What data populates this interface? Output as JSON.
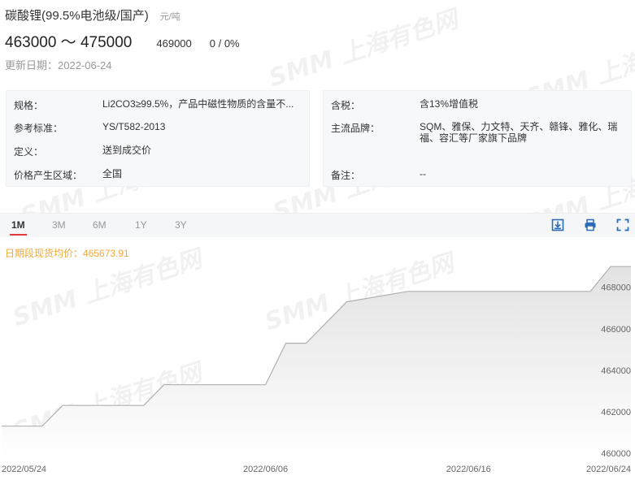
{
  "product": {
    "title": "碳酸锂(99.5%电池级/国产)",
    "unit": "元/吨",
    "price_range": "463000 ～ 475000",
    "average": "469000",
    "change": "0 / 0%",
    "updated": "更新日期：2022-06-24"
  },
  "details": {
    "left": [
      {
        "label": "规格：",
        "value": "Li2CO3≥99.5%，产品中磁性物质的含量不..."
      },
      {
        "label": "参考标准：",
        "value": "YS/T582-2013"
      },
      {
        "label": "定义：",
        "value": "送到成交价"
      },
      {
        "label": "价格产生区域：",
        "value": "全国"
      }
    ],
    "right": [
      {
        "label": "含税：",
        "value": "含13%增值税"
      },
      {
        "label": "主流品牌：",
        "value_line1": "SQM、雅保、力文特、天齐、赣锋、雅化、瑞",
        "value_line2": "福、容汇等厂家旗下品牌"
      },
      {
        "label": "备注：",
        "value": "--"
      }
    ]
  },
  "tabs": [
    "1M",
    "3M",
    "6M",
    "1Y",
    "3Y"
  ],
  "active_tab": "1M",
  "tools": [
    "download-icon",
    "print-icon",
    "fullscreen-icon"
  ],
  "watermark": "SMM 上海有色网",
  "chart_label": "日期段现货均价：465673.91",
  "chart_data": {
    "type": "area",
    "series": [
      {
        "values": [
          [
            "2022-05-24",
            461300
          ],
          [
            "2022-05-25",
            461300
          ],
          [
            "2022-05-26",
            461300
          ],
          [
            "2022-05-27",
            462300
          ],
          [
            "2022-05-30",
            462300
          ],
          [
            "2022-05-31",
            462300
          ],
          [
            "2022-06-01",
            463300
          ],
          [
            "2022-06-02",
            463300
          ],
          [
            "2022-06-06",
            463300
          ],
          [
            "2022-06-07",
            465300
          ],
          [
            "2022-06-08",
            465300
          ],
          [
            "2022-06-09",
            466300
          ],
          [
            "2022-06-10",
            467300
          ],
          [
            "2022-06-13",
            467800
          ],
          [
            "2022-06-14",
            467800
          ],
          [
            "2022-06-15",
            467800
          ],
          [
            "2022-06-16",
            467800
          ],
          [
            "2022-06-17",
            467800
          ],
          [
            "2022-06-20",
            467800
          ],
          [
            "2022-06-21",
            467800
          ],
          [
            "2022-06-22",
            467800
          ],
          [
            "2022-06-23",
            469000
          ],
          [
            "2022-06-24",
            469000
          ]
        ]
      }
    ],
    "x_ticks": [
      "2022/05/24",
      "2022/06/06",
      "2022/06/16",
      "2022/06/24"
    ],
    "y_ticks": [
      "460000",
      "462000",
      "464000",
      "466000",
      "468000"
    ],
    "ylim": [
      459800,
      469400
    ],
    "colors": {
      "line": "#b0b0b0",
      "fill_top": "#e2e2e2",
      "fill_bottom": "#ffffff"
    }
  }
}
